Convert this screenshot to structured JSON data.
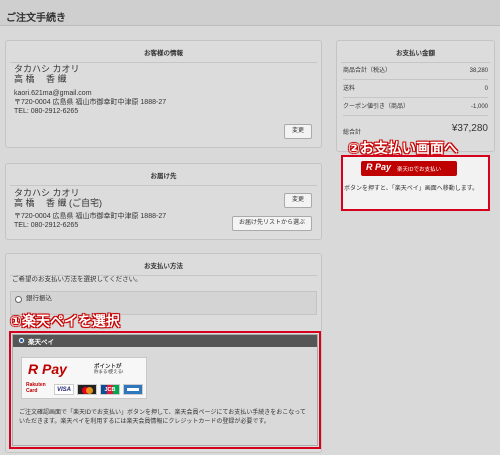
{
  "header": {
    "title": "ご注文手続き"
  },
  "customer": {
    "title": "お客様の情報",
    "kana": "タカハシ カオリ",
    "name": "高 橋　 香 織",
    "email": "kaori.621ma@gmail.com",
    "address": "〒720-0004 広島県 福山市御幸町中津原 1888-27",
    "tel": "TEL: 080-2912-6265",
    "change_label": "変更"
  },
  "shipping": {
    "title": "お届け先",
    "kana": "タカハシ カオリ",
    "name": "高 橋　 香 織 (ご自宅)",
    "address": "〒720-0004 広島県 福山市御幸町中津原 1888-27",
    "tel": "TEL: 080-2912-6265",
    "change_label": "変更",
    "list_label": "お届け先リストから選ぶ"
  },
  "payment": {
    "title": "お支払い方法",
    "prompt": "ご希望のお支払い方法を選択してください。",
    "option_bank": "銀行振込",
    "option_rakuten": "楽天ペイ",
    "rpay_logo": "R Pay",
    "rpay_promo_1": "ポイントが",
    "rpay_promo_2": "貯まる!使える!",
    "rakuten_card_1": "Rakuten",
    "rakuten_card_2": "Card",
    "visa": "VISA",
    "jcb": "JCB",
    "description": "ご注文確認画面で「楽天IDでお支払い」ボタンを押して、楽天会員ページにてお支払い手続きをおこなっていただきます。楽天ペイを利用するには楽天会員情報にクレジットカードの登録が必要です。"
  },
  "summary": {
    "title": "お支払い金額",
    "rows": [
      {
        "label": "商品合計（税込）",
        "value": "38,280"
      },
      {
        "label": "送料",
        "value": "0"
      },
      {
        "label": "クーポン値引き（商品）",
        "value": "-1,000"
      }
    ],
    "total_label": "総合計",
    "total_value": "¥37,280",
    "pay_button": "楽天IDでお支払い",
    "pay_button_logo": "R Pay",
    "note": "ボタンを押すと、「楽天ペイ」画面へ移動します。"
  },
  "annotations": {
    "step1": "①楽天ペイを選択",
    "step2": "②お支払い画面へ"
  },
  "colors": {
    "accent": "#d6001c",
    "overlay": "#d9d9d9"
  }
}
